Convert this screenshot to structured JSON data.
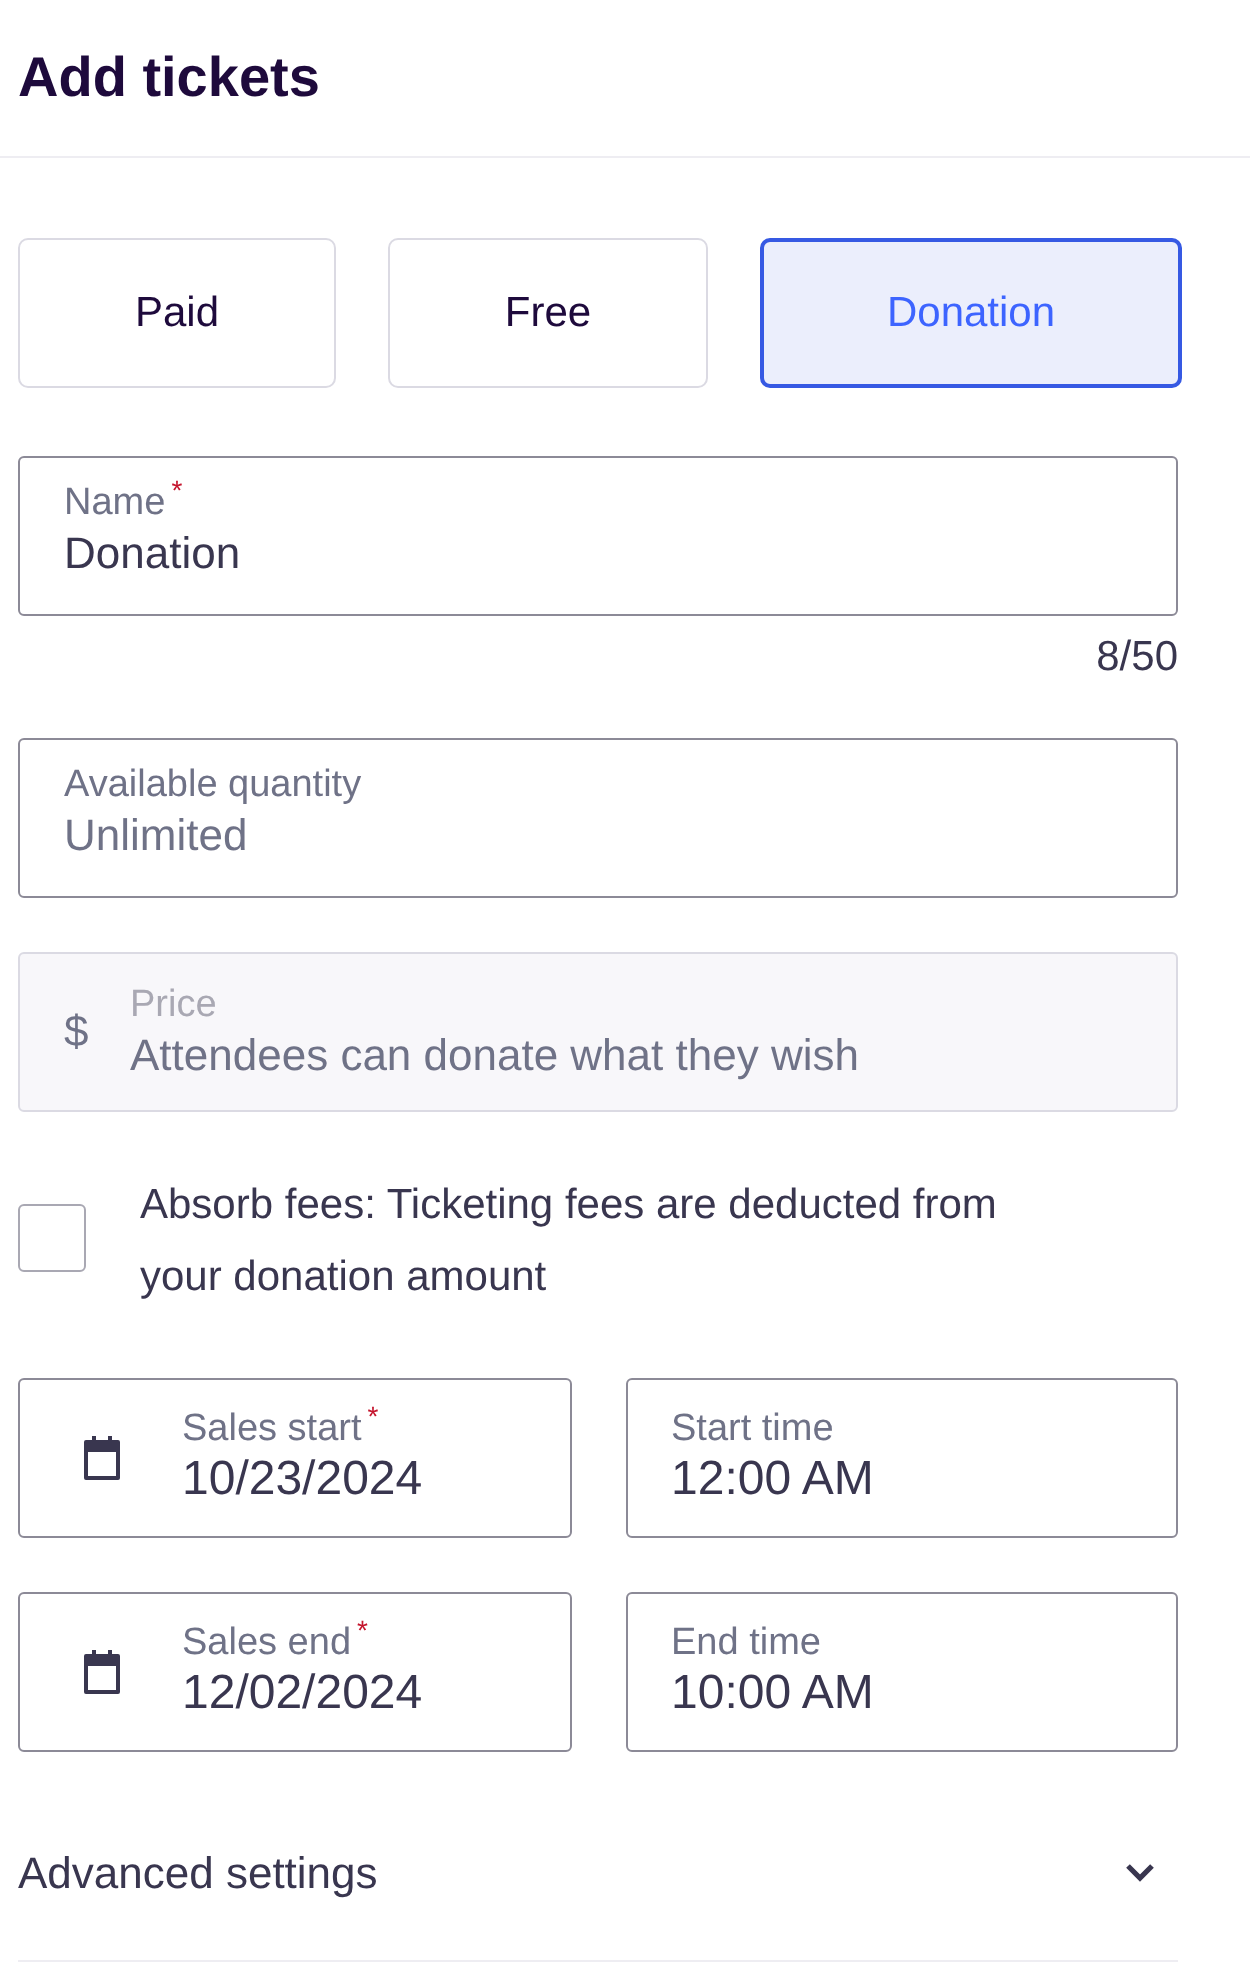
{
  "header": {
    "title": "Add tickets"
  },
  "ticket_types": [
    {
      "label": "Paid",
      "selected": false
    },
    {
      "label": "Free",
      "selected": false
    },
    {
      "label": "Donation",
      "selected": true
    }
  ],
  "fields": [
    {
      "kind": "text",
      "label": "Name$^{*}$",
      "value": "Donation",
      "counter": "8/50",
      "disabled": false
    },
    {
      "kind": "text",
      "label": "Available quantity",
      "placeholder": "Unlimited",
      "disabled": false
    },
    {
      "kind": "currency",
      "prefix": "$",
      "label": "Price",
      "placeholder": "Attendees can donate what they wish",
      "disabled": true
    }
  ],
  "absorb_fees": {
    "label": "Absorb fees: Ticketing fees are deducted from your donation amount",
    "checked": false
  },
  "schedule": [
    {
      "kind": "date",
      "label": "Sales start$^{*}$",
      "value": "10/23/2024"
    },
    {
      "kind": "time",
      "label": "Start time",
      "value": "12:00 AM"
    },
    {
      "kind": "date",
      "label": "Sales end$^{*}$",
      "value": "12/02/2024"
    },
    {
      "kind": "time",
      "label": "End time",
      "value": "10:00 AM"
    }
  ],
  "advanced_settings": {
    "label": "Advanced settings",
    "expanded": false
  }
}
